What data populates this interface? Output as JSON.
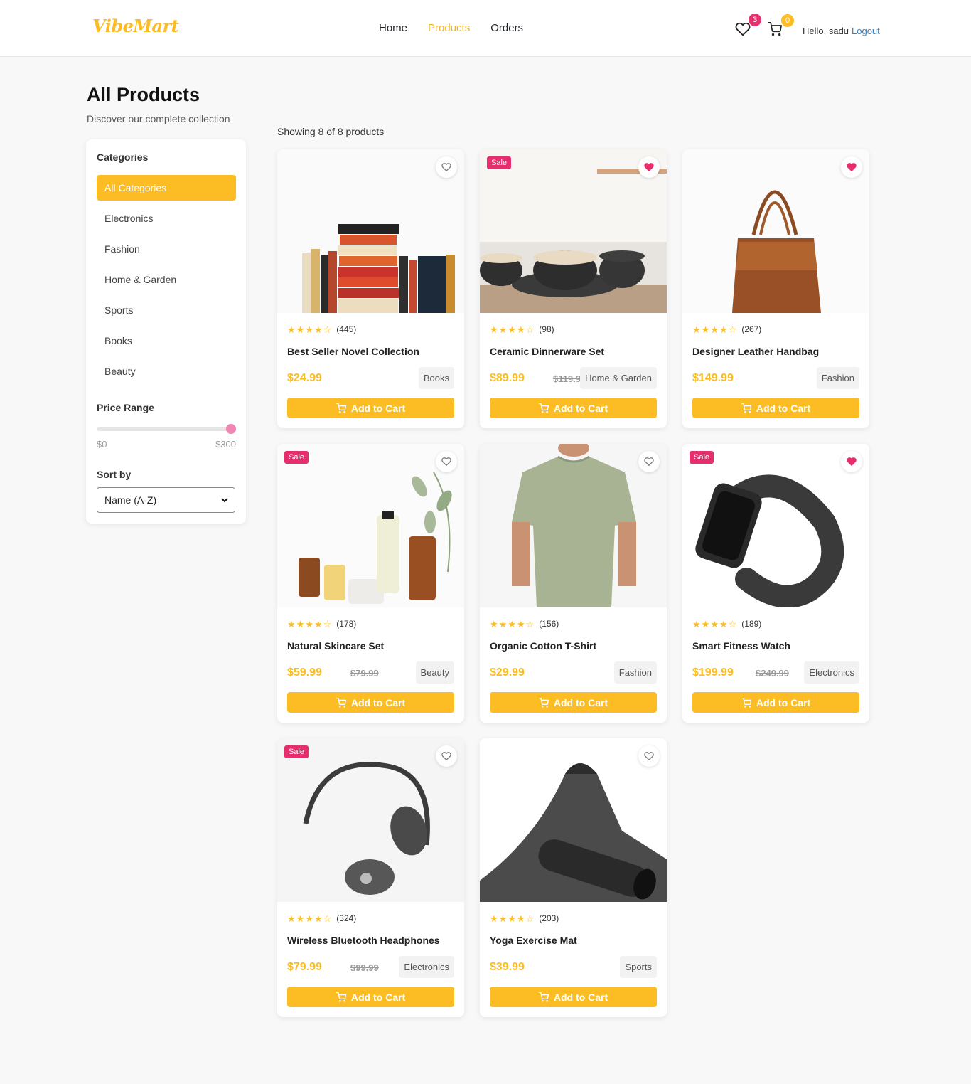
{
  "header": {
    "logo": "VibeMart",
    "nav": [
      {
        "label": "Home",
        "active": false
      },
      {
        "label": "Products",
        "active": true
      },
      {
        "label": "Orders",
        "active": false
      }
    ],
    "wishlist_icon": "heart-icon",
    "wishlist_count": "3",
    "cart_icon": "cart-icon",
    "cart_count": "0",
    "greeting": "Hello, sadu",
    "logout": "Logout"
  },
  "page": {
    "title": "All Products",
    "subtitle": "Discover our complete collection",
    "showing": "Showing 8 of 8 products"
  },
  "sidebar": {
    "categories_heading": "Categories",
    "categories": [
      {
        "label": "All Categories",
        "active": true
      },
      {
        "label": "Electronics",
        "active": false
      },
      {
        "label": "Fashion",
        "active": false
      },
      {
        "label": "Home & Garden",
        "active": false
      },
      {
        "label": "Sports",
        "active": false
      },
      {
        "label": "Books",
        "active": false
      },
      {
        "label": "Beauty",
        "active": false
      }
    ],
    "price_heading": "Price Range",
    "price_min": "$0",
    "price_max": "$300",
    "price_value_fraction": 1.0,
    "sort_heading": "Sort by",
    "sort_value": "Name (A-Z)"
  },
  "colors": {
    "accent": "#fbbd23",
    "sale": "#e62e6e",
    "link": "#2f7ec0"
  },
  "add_to_cart_label": "Add to Cart",
  "products": [
    {
      "name": "Best Seller Novel Collection",
      "rating_count": "(445)",
      "stars": 4,
      "price": "$24.99",
      "old_price": "",
      "category": "Books",
      "sale": false,
      "wishlisted": false,
      "image": "books"
    },
    {
      "name": "Ceramic Dinnerware Set",
      "rating_count": "(98)",
      "stars": 4,
      "price": "$89.99",
      "old_price": "$119.99",
      "category": "Home & Garden",
      "sale": true,
      "wishlisted": true,
      "image": "dinnerware"
    },
    {
      "name": "Designer Leather Handbag",
      "rating_count": "(267)",
      "stars": 4,
      "price": "$149.99",
      "old_price": "",
      "category": "Fashion",
      "sale": false,
      "wishlisted": true,
      "image": "handbag"
    },
    {
      "name": "Natural Skincare Set",
      "rating_count": "(178)",
      "stars": 4,
      "price": "$59.99",
      "old_price": "$79.99",
      "category": "Beauty",
      "sale": true,
      "wishlisted": false,
      "image": "skincare"
    },
    {
      "name": "Organic Cotton T-Shirt",
      "rating_count": "(156)",
      "stars": 4,
      "price": "$29.99",
      "old_price": "",
      "category": "Fashion",
      "sale": false,
      "wishlisted": false,
      "image": "tshirt"
    },
    {
      "name": "Smart Fitness Watch",
      "rating_count": "(189)",
      "stars": 4,
      "price": "$199.99",
      "old_price": "$249.99",
      "category": "Electronics",
      "sale": true,
      "wishlisted": true,
      "image": "watch"
    },
    {
      "name": "Wireless Bluetooth Headphones",
      "rating_count": "(324)",
      "stars": 4,
      "price": "$79.99",
      "old_price": "$99.99",
      "category": "Electronics",
      "sale": true,
      "wishlisted": false,
      "image": "headphones"
    },
    {
      "name": "Yoga Exercise Mat",
      "rating_count": "(203)",
      "stars": 4,
      "price": "$39.99",
      "old_price": "",
      "category": "Sports",
      "sale": false,
      "wishlisted": false,
      "image": "yogamat"
    }
  ],
  "sale_label": "Sale"
}
